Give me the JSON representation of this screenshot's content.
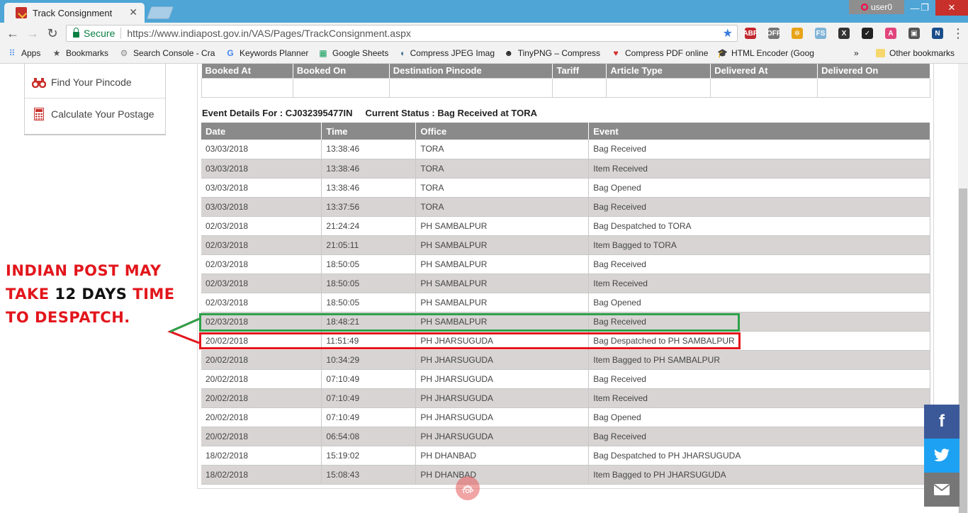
{
  "browser": {
    "tab_title": "Track Consignment",
    "tab_close": "✕",
    "user_name": "user0",
    "minimize": "—",
    "maximize": "❐",
    "close": "✕",
    "secure_label": "Secure",
    "url": "https://www.indiapost.gov.in/VAS/Pages/TrackConsignment.aspx",
    "back": "←",
    "forward": "→",
    "reload": "↻",
    "bookmark_star": "★",
    "menu": "⋮",
    "extensions": [
      {
        "label": "ABP",
        "color": "#c1272d"
      },
      {
        "label": "OFF",
        "color": "#777777"
      },
      {
        "label": "✲",
        "color": "#e8a317"
      },
      {
        "label": "FS",
        "color": "#7fb3d5"
      },
      {
        "label": "X",
        "color": "#333333"
      },
      {
        "label": "✓",
        "color": "#222222"
      },
      {
        "label": "A",
        "color": "#e0457b"
      },
      {
        "label": "▣",
        "color": "#555555"
      },
      {
        "label": "N",
        "color": "#1a4e8a"
      }
    ]
  },
  "bookmarks": {
    "items": [
      {
        "label": "Apps",
        "icon": "apps-icon"
      },
      {
        "label": "Bookmarks",
        "icon": "star-icon"
      },
      {
        "label": "Search Console - Cra",
        "icon": "search-console-icon"
      },
      {
        "label": "Keywords Planner",
        "icon": "google-icon"
      },
      {
        "label": "Google Sheets",
        "icon": "sheets-icon"
      },
      {
        "label": "Compress JPEG Imag",
        "icon": "compress-jpeg-icon"
      },
      {
        "label": "TinyPNG – Compress",
        "icon": "panda-icon"
      },
      {
        "label": "Compress PDF online",
        "icon": "heart-icon"
      },
      {
        "label": "HTML Encoder (Goog",
        "icon": "hat-icon"
      }
    ],
    "overflow": "»",
    "other": "Other bookmarks"
  },
  "sidebar": {
    "items": [
      {
        "label": "Find Your Pincode"
      },
      {
        "label": "Calculate Your Postage"
      }
    ]
  },
  "booking_table": {
    "headers": [
      "Booked At",
      "Booked On",
      "Destination Pincode",
      "Tariff",
      "Article Type",
      "Delivered At",
      "Delivered On"
    ]
  },
  "event_details": {
    "label": "Event Details For :",
    "article_id": "CJ032395477IN",
    "status_label": "Current Status :",
    "status": "Bag Received at TORA",
    "headers": [
      "Date",
      "Time",
      "Office",
      "Event"
    ],
    "rows": [
      [
        "03/03/2018",
        "13:38:46",
        "TORA",
        "Bag Received"
      ],
      [
        "03/03/2018",
        "13:38:46",
        "TORA",
        "Item Received"
      ],
      [
        "03/03/2018",
        "13:38:46",
        "TORA",
        "Bag Opened"
      ],
      [
        "03/03/2018",
        "13:37:56",
        "TORA",
        "Bag Received"
      ],
      [
        "02/03/2018",
        "21:24:24",
        "PH SAMBALPUR",
        "Bag Despatched to TORA"
      ],
      [
        "02/03/2018",
        "21:05:11",
        "PH SAMBALPUR",
        "Item Bagged to TORA"
      ],
      [
        "02/03/2018",
        "18:50:05",
        "PH SAMBALPUR",
        "Bag Received"
      ],
      [
        "02/03/2018",
        "18:50:05",
        "PH SAMBALPUR",
        "Item Received"
      ],
      [
        "02/03/2018",
        "18:50:05",
        "PH SAMBALPUR",
        "Bag Opened"
      ],
      [
        "02/03/2018",
        "18:48:21",
        "PH SAMBALPUR",
        "Bag Received"
      ],
      [
        "20/02/2018",
        "11:51:49",
        "PH JHARSUGUDA",
        "Bag Despatched to PH SAMBALPUR"
      ],
      [
        "20/02/2018",
        "10:34:29",
        "PH JHARSUGUDA",
        "Item Bagged to PH SAMBALPUR"
      ],
      [
        "20/02/2018",
        "07:10:49",
        "PH JHARSUGUDA",
        "Bag Received"
      ],
      [
        "20/02/2018",
        "07:10:49",
        "PH JHARSUGUDA",
        "Item Received"
      ],
      [
        "20/02/2018",
        "07:10:49",
        "PH JHARSUGUDA",
        "Bag Opened"
      ],
      [
        "20/02/2018",
        "06:54:08",
        "PH JHARSUGUDA",
        "Bag Received"
      ],
      [
        "18/02/2018",
        "15:19:02",
        "PH DHANBAD",
        "Bag Despatched to PH JHARSUGUDA"
      ],
      [
        "18/02/2018",
        "15:08:43",
        "PH DHANBAD",
        "Item Bagged to PH JHARSUGUDA"
      ]
    ]
  },
  "annotation": {
    "line1": "INDIAN POST MAY",
    "line2_a": "TAKE ",
    "line2_b": "12 DAYS",
    "line2_c": " TIME",
    "line3": "TO DESPATCH."
  },
  "social": {
    "facebook": {
      "glyph": "f",
      "color": "#3b5998"
    },
    "twitter": {
      "glyph": "🐦",
      "color": "#1da1f2"
    },
    "email": {
      "glyph": "✉",
      "color": "#777777"
    }
  },
  "top_button": {
    "arrow": "︽",
    "label": "TOP"
  }
}
